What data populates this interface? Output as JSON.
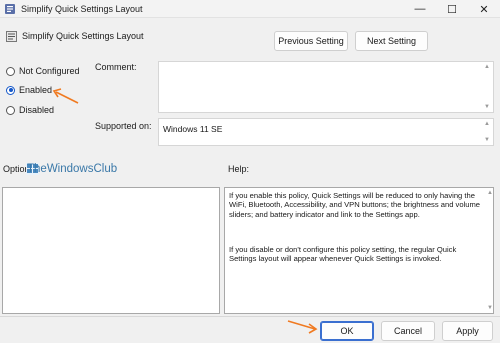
{
  "window": {
    "title": "Simplify Quick Settings Layout",
    "controls": {
      "minimize": "—",
      "maximize": "☐",
      "close": "✕"
    }
  },
  "header": {
    "title": "Simplify Quick Settings Layout",
    "prev_label": "Previous Setting",
    "next_label": "Next Setting"
  },
  "state": {
    "options": [
      {
        "label": "Not Configured",
        "checked": false
      },
      {
        "label": "Enabled",
        "checked": true
      },
      {
        "label": "Disabled",
        "checked": false
      }
    ]
  },
  "fields": {
    "comment_label": "Comment:",
    "comment_value": "",
    "supported_label": "Supported on:",
    "supported_value": "Windows 11 SE"
  },
  "panels": {
    "options_label": "Options:",
    "help_label": "Help:",
    "help_paragraphs": [
      "If you enable this policy, Quick Settings will be reduced to only having the WiFi, Bluetooth, Accessibility, and VPN buttons; the brightness and volume sliders; and battery indicator and link to the Settings app.",
      "If you disable or don't configure this policy setting, the regular Quick Settings layout will appear whenever Quick Settings is invoked."
    ]
  },
  "watermark": {
    "text": "TheWindowsClub"
  },
  "footer": {
    "ok_label": "OK",
    "cancel_label": "Cancel",
    "apply_label": "Apply"
  },
  "colors": {
    "accent": "#1558c9",
    "annotation_arrow": "#f07a21"
  }
}
